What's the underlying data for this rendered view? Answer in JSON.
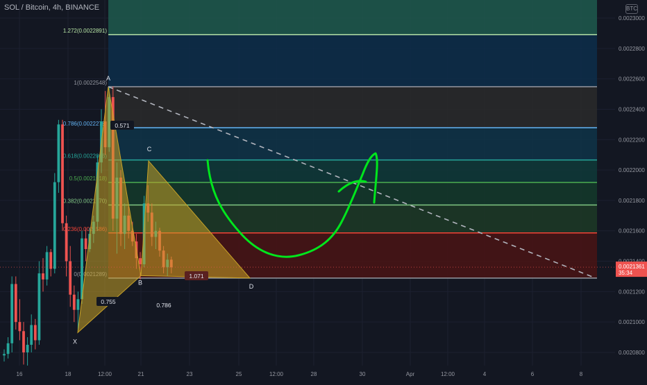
{
  "header": {
    "symbol_title": "SOL / Bitcoin, 4h, BINANCE",
    "currency_badge": "BTC"
  },
  "colors": {
    "background": "#131722",
    "grid": "#1c2030",
    "candle_up": "#26a69a",
    "candle_down": "#ef5350",
    "harmonic_fill": "#c9a227",
    "fib_levels": {
      "1.272": "#b7e5a6",
      "1": "#9598a1",
      "0.786": "#64b5f6",
      "0.618": "#26a69a",
      "0.5": "#4caf50",
      "0.382": "#81c784",
      "0.236": "#f44336",
      "0": "#9598a1"
    },
    "freehand_drawing": "#00e61d",
    "price_tag": "#ef5350"
  },
  "price_tag": {
    "price": "0.0021361",
    "countdown": "35:34"
  },
  "chart_data": {
    "type": "candlestick",
    "symbol": "SOL / Bitcoin",
    "interval": "4h",
    "exchange": "BINANCE",
    "y_axis": {
      "ylim": [
        0.00207,
        0.002305
      ],
      "ticks": [
        "0.0020800",
        "0.0021000",
        "0.0021200",
        "0.0021400",
        "0.0021600",
        "0.0021800",
        "0.0022000",
        "0.0022200",
        "0.0022400",
        "0.0022600",
        "0.0022800",
        "0.0023000"
      ]
    },
    "x_axis": {
      "ticks": [
        "16",
        "18",
        "12:00",
        "21",
        "23",
        "25",
        "12:00",
        "28",
        "30",
        "Apr",
        "12:00",
        "4",
        "6",
        "8"
      ]
    },
    "candles": [
      {
        "o": 0.002078,
        "h": 0.002082,
        "l": 0.002074,
        "c": 0.002079
      },
      {
        "o": 0.002079,
        "h": 0.00209,
        "l": 0.002076,
        "c": 0.002086
      },
      {
        "o": 0.002086,
        "h": 0.00213,
        "l": 0.00208,
        "c": 0.002125
      },
      {
        "o": 0.002125,
        "h": 0.00213,
        "l": 0.002095,
        "c": 0.0021
      },
      {
        "o": 0.0021,
        "h": 0.002115,
        "l": 0.002088,
        "c": 0.002094
      },
      {
        "o": 0.002094,
        "h": 0.0021,
        "l": 0.002072,
        "c": 0.00208
      },
      {
        "o": 0.00208,
        "h": 0.00209,
        "l": 0.00207,
        "c": 0.002085
      },
      {
        "o": 0.002085,
        "h": 0.002105,
        "l": 0.00208,
        "c": 0.002098
      },
      {
        "o": 0.002098,
        "h": 0.002102,
        "l": 0.002082,
        "c": 0.002088
      },
      {
        "o": 0.002088,
        "h": 0.00214,
        "l": 0.002085,
        "c": 0.002132
      },
      {
        "o": 0.002132,
        "h": 0.002142,
        "l": 0.00212,
        "c": 0.002128
      },
      {
        "o": 0.002128,
        "h": 0.00215,
        "l": 0.002124,
        "c": 0.002146
      },
      {
        "o": 0.002146,
        "h": 0.002148,
        "l": 0.00213,
        "c": 0.002135
      },
      {
        "o": 0.002135,
        "h": 0.002198,
        "l": 0.002132,
        "c": 0.002192
      },
      {
        "o": 0.002192,
        "h": 0.002233,
        "l": 0.002185,
        "c": 0.00223
      },
      {
        "o": 0.00223,
        "h": 0.002233,
        "l": 0.00216,
        "c": 0.002165
      },
      {
        "o": 0.002165,
        "h": 0.00217,
        "l": 0.00213,
        "c": 0.00214
      },
      {
        "o": 0.00214,
        "h": 0.00215,
        "l": 0.00211,
        "c": 0.002118
      },
      {
        "o": 0.002118,
        "h": 0.002124,
        "l": 0.0021,
        "c": 0.002108
      },
      {
        "o": 0.002108,
        "h": 0.00212,
        "l": 0.002094,
        "c": 0.002115
      },
      {
        "o": 0.002115,
        "h": 0.00216,
        "l": 0.002112,
        "c": 0.002155
      },
      {
        "o": 0.002155,
        "h": 0.002162,
        "l": 0.00214,
        "c": 0.002148
      },
      {
        "o": 0.002148,
        "h": 0.002162,
        "l": 0.002146,
        "c": 0.002158
      },
      {
        "o": 0.002158,
        "h": 0.00217,
        "l": 0.002152,
        "c": 0.002166
      },
      {
        "o": 0.002166,
        "h": 0.00221,
        "l": 0.00216,
        "c": 0.002205
      },
      {
        "o": 0.002205,
        "h": 0.00224,
        "l": 0.002198,
        "c": 0.002232
      },
      {
        "o": 0.002232,
        "h": 0.002252,
        "l": 0.00221,
        "c": 0.002215
      },
      {
        "o": 0.002215,
        "h": 0.002255,
        "l": 0.002212,
        "c": 0.002248
      },
      {
        "o": 0.002248,
        "h": 0.002255,
        "l": 0.00216,
        "c": 0.002168
      },
      {
        "o": 0.002168,
        "h": 0.002205,
        "l": 0.002145,
        "c": 0.002195
      },
      {
        "o": 0.002195,
        "h": 0.0022,
        "l": 0.00215,
        "c": 0.002158
      },
      {
        "o": 0.002158,
        "h": 0.002178,
        "l": 0.002148,
        "c": 0.00217
      },
      {
        "o": 0.00217,
        "h": 0.002176,
        "l": 0.002155,
        "c": 0.00216
      },
      {
        "o": 0.00216,
        "h": 0.002166,
        "l": 0.00215,
        "c": 0.002153
      },
      {
        "o": 0.002153,
        "h": 0.002158,
        "l": 0.002135,
        "c": 0.002142
      },
      {
        "o": 0.002142,
        "h": 0.002146,
        "l": 0.002128,
        "c": 0.002138
      },
      {
        "o": 0.002138,
        "h": 0.002183,
        "l": 0.002136,
        "c": 0.002178
      },
      {
        "o": 0.002178,
        "h": 0.00219,
        "l": 0.002166,
        "c": 0.002172
      },
      {
        "o": 0.002172,
        "h": 0.002178,
        "l": 0.00215,
        "c": 0.002156
      },
      {
        "o": 0.002156,
        "h": 0.002166,
        "l": 0.002148,
        "c": 0.00216
      },
      {
        "o": 0.00216,
        "h": 0.002162,
        "l": 0.002143,
        "c": 0.002147
      },
      {
        "o": 0.002147,
        "h": 0.00215,
        "l": 0.002132,
        "c": 0.002136
      },
      {
        "o": 0.002136,
        "h": 0.002145,
        "l": 0.00213,
        "c": 0.002141
      },
      {
        "o": 0.002141,
        "h": 0.002143,
        "l": 0.002132,
        "c": 0.002136
      }
    ],
    "fib_retracement": [
      {
        "ratio": "1.272",
        "label": "1.272(0.0022891)",
        "price": 0.0022891
      },
      {
        "ratio": "1",
        "label": "1(0.0022548)",
        "price": 0.0022548
      },
      {
        "ratio": "0.786",
        "label": "0.786(0.0022278)",
        "price": 0.0022278
      },
      {
        "ratio": "0.618",
        "label": "0.618(0.0022066)",
        "price": 0.0022066
      },
      {
        "ratio": "0.5",
        "label": "0.5(0.0021918)",
        "price": 0.0021918
      },
      {
        "ratio": "0.382",
        "label": "0.382(0.0021770)",
        "price": 0.002177
      },
      {
        "ratio": "0.236",
        "label": "0.236(0.0021586)",
        "price": 0.0021586
      },
      {
        "ratio": "0",
        "label": "0(0.0021289)",
        "price": 0.0021289
      }
    ],
    "harmonic_pattern": {
      "points": [
        {
          "name": "X",
          "price": 0.002093
        },
        {
          "name": "A",
          "price": 0.0022548
        },
        {
          "name": "B",
          "price": 0.0021305
        },
        {
          "name": "C",
          "price": 0.002206
        },
        {
          "name": "D",
          "price": 0.0021289
        }
      ],
      "ratio_labels": [
        "0.571",
        "0.755",
        "0.786",
        "1.071"
      ]
    },
    "trendline": {
      "style": "dashed",
      "from_price": 0.0022548,
      "to_price": 0.0021289
    },
    "freehand_curve": {
      "color": "#00e61d"
    },
    "grid": true
  }
}
